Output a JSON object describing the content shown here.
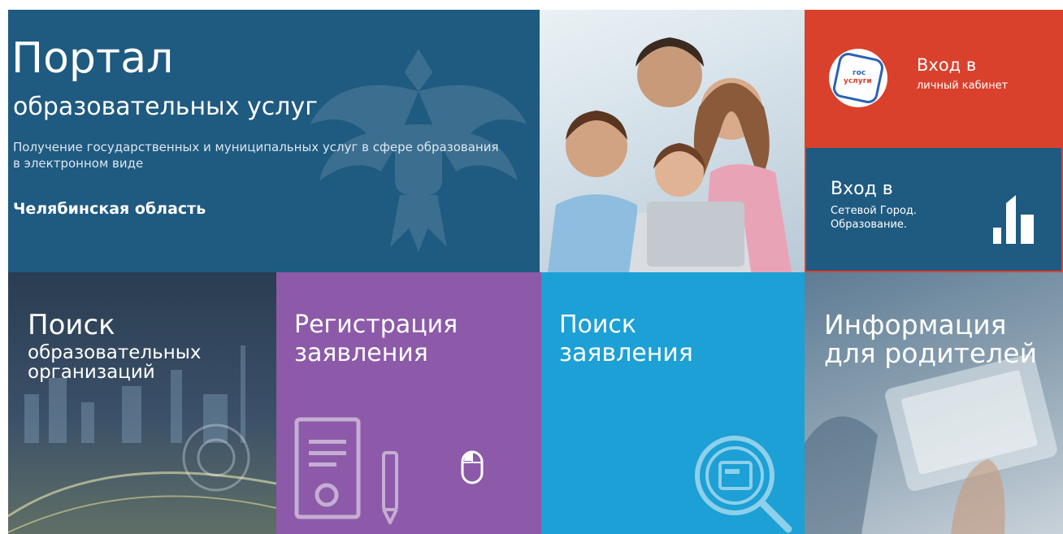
{
  "hero": {
    "title": "Портал",
    "subtitle": "образовательных услуг",
    "description": "Получение государственных и муниципальных услуг в сфере образования в электронном виде",
    "region": "Челябинская область"
  },
  "gosuslugi": {
    "logo_top": "гос",
    "logo_bottom": "услуги",
    "title": "Вход в",
    "subtitle": "личный кабинет"
  },
  "network_city": {
    "title": "Вход в",
    "subtitle": "Сетевой Город. Образование."
  },
  "tiles": {
    "search_org": {
      "title": "Поиск",
      "subtitle": "образовательных организаций"
    },
    "register": {
      "title": "Регистрация заявления"
    },
    "search_app": {
      "title": "Поиск заявления"
    },
    "info": {
      "title": "Информация для родителей"
    }
  },
  "colors": {
    "hero": "#1f5a80",
    "gosuslugi": "#d9412c",
    "register": "#8c5aa8",
    "search_app": "#1ca0d5"
  },
  "icons": [
    "emblem-icon",
    "gosuslugi-logo-icon",
    "bar-chart-icon",
    "document-icon",
    "pencil-icon",
    "mouse-icon",
    "magnifier-icon"
  ]
}
